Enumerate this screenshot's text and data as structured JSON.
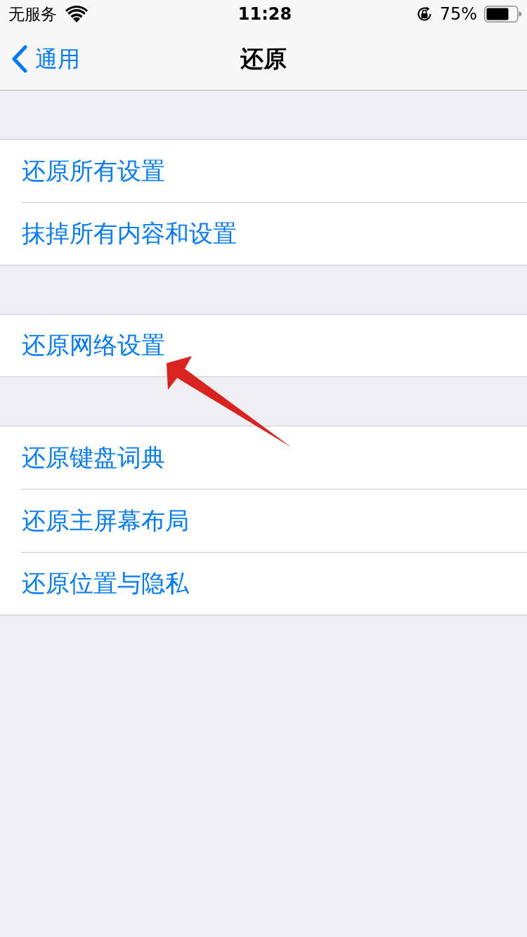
{
  "status_bar": {
    "carrier": "无服务",
    "time": "11:28",
    "battery_percent": "75%"
  },
  "nav_bar": {
    "back_label": "通用",
    "title": "还原"
  },
  "groups": [
    {
      "items": [
        {
          "label": "还原所有设置"
        },
        {
          "label": "抹掉所有内容和设置"
        }
      ]
    },
    {
      "items": [
        {
          "label": "还原网络设置"
        }
      ]
    },
    {
      "items": [
        {
          "label": "还原键盘词典"
        },
        {
          "label": "还原主屏幕布局"
        },
        {
          "label": "还原位置与隐私"
        }
      ]
    }
  ]
}
